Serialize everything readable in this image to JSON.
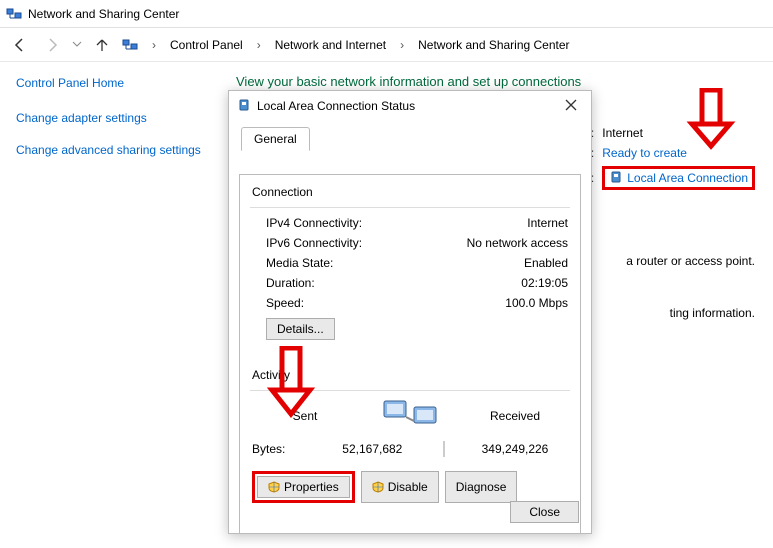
{
  "titlebar": {
    "title": "Network and Sharing Center"
  },
  "nav": {
    "crumbs": [
      "Control Panel",
      "Network and Internet",
      "Network and Sharing Center"
    ]
  },
  "sidebar": {
    "home": "Control Panel Home",
    "links": [
      "Change adapter settings",
      "Change advanced sharing settings"
    ]
  },
  "main": {
    "heading": "View your basic network information and set up connections",
    "net_panel": {
      "access_type_label": "pe:",
      "access_type_value": "Internet",
      "homegroup_label": "up:",
      "homegroup_value": "Ready to create",
      "connections_label": "ons:",
      "connections_value": "Local Area Connection"
    },
    "hint1": "a router or access point.",
    "hint2": "ting information."
  },
  "dialog": {
    "title": "Local Area Connection Status",
    "tab": "General",
    "connection_group": "Connection",
    "rows": [
      {
        "label": "IPv4 Connectivity:",
        "value": "Internet"
      },
      {
        "label": "IPv6 Connectivity:",
        "value": "No network access"
      },
      {
        "label": "Media State:",
        "value": "Enabled"
      },
      {
        "label": "Duration:",
        "value": "02:19:05"
      },
      {
        "label": "Speed:",
        "value": "100.0 Mbps"
      }
    ],
    "details_btn": "Details...",
    "activity_group": "Activity",
    "sent_label": "Sent",
    "received_label": "Received",
    "bytes_label": "Bytes:",
    "bytes_sent": "52,167,682",
    "bytes_received": "349,249,226",
    "properties_btn": "Properties",
    "disable_btn": "Disable",
    "diagnose_btn": "Diagnose",
    "close_btn": "Close"
  }
}
